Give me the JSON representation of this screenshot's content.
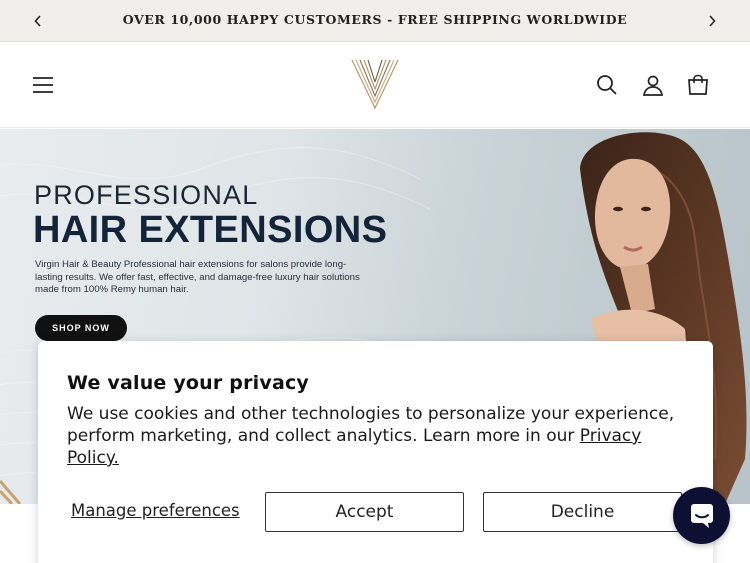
{
  "announcement": {
    "text": "OVER 10,000 HAPPY CUSTOMERS - FREE SHIPPING WORLDWIDE",
    "prev_icon": "chevron-left-icon",
    "next_icon": "chevron-right-icon"
  },
  "header": {
    "menu_icon": "hamburger-menu-icon",
    "logo": "v-monogram-logo",
    "search_icon": "search-icon",
    "account_icon": "account-icon",
    "cart_icon": "cart-icon"
  },
  "hero": {
    "kicker": "PROFESSIONAL",
    "headline": "HAIR EXTENSIONS",
    "description": "Virgin Hair & Beauty Professional hair extensions for salons provide long-lasting results. We offer fast, effective, and damage-free luxury hair solutions made from 100% Remy human hair.",
    "cta_label": "SHOP NOW"
  },
  "cookie_banner": {
    "title": "We value your privacy",
    "body_text": "We use cookies and other technologies to personalize your experience, perform marketing, and collect analytics. Learn more in our ",
    "policy_link": "Privacy Policy.",
    "manage_label": "Manage preferences",
    "accept_label": "Accept",
    "decline_label": "Decline"
  },
  "chat": {
    "icon": "chat-bubble-icon"
  },
  "colors": {
    "announcement_bg": "#f1efeb",
    "cta_bg": "#111111",
    "headline": "#13233a",
    "chat_bg": "#0d1033",
    "logo_gold": "#b59a6a"
  }
}
